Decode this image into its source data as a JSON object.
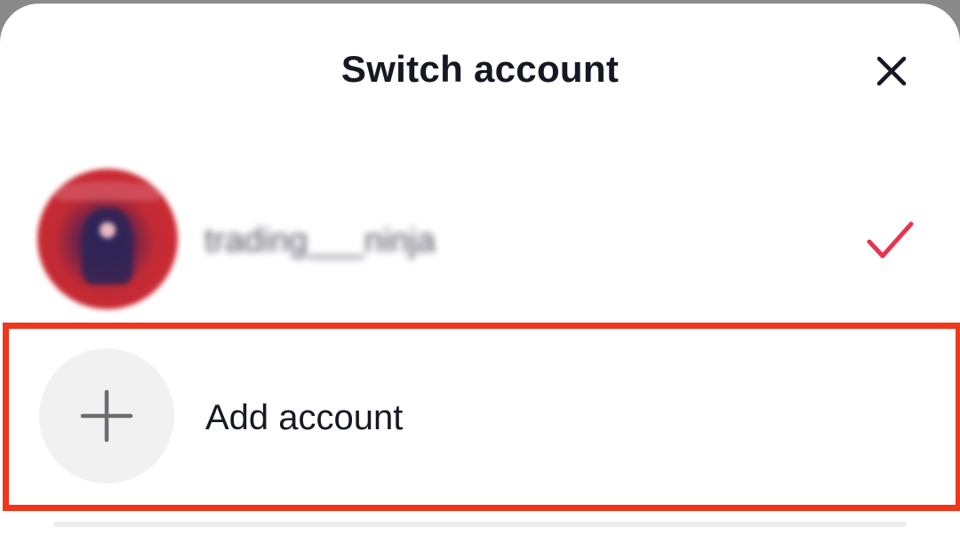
{
  "sheet": {
    "title": "Switch account"
  },
  "accounts": [
    {
      "username": "trading___ninja",
      "selected": true
    }
  ],
  "add_account": {
    "label": "Add account"
  },
  "colors": {
    "check": "#e8344f",
    "highlight": "#f0371c",
    "title_text": "#161823"
  },
  "icons": {
    "close": "close-icon",
    "check": "check-icon",
    "add": "plus-icon"
  }
}
